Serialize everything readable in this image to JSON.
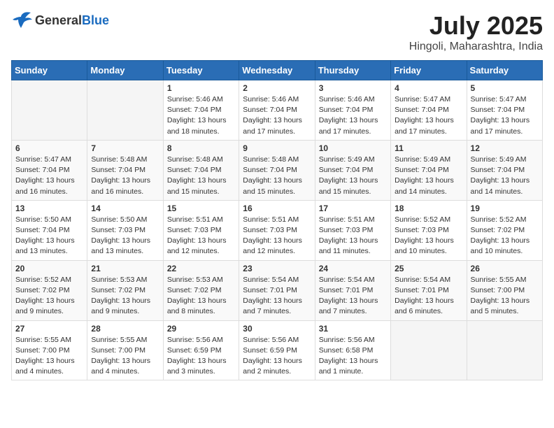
{
  "header": {
    "logo_general": "General",
    "logo_blue": "Blue",
    "month": "July 2025",
    "location": "Hingoli, Maharashtra, India"
  },
  "weekdays": [
    "Sunday",
    "Monday",
    "Tuesday",
    "Wednesday",
    "Thursday",
    "Friday",
    "Saturday"
  ],
  "weeks": [
    [
      {
        "day": "",
        "info": ""
      },
      {
        "day": "",
        "info": ""
      },
      {
        "day": "1",
        "info": "Sunrise: 5:46 AM\nSunset: 7:04 PM\nDaylight: 13 hours and 18 minutes."
      },
      {
        "day": "2",
        "info": "Sunrise: 5:46 AM\nSunset: 7:04 PM\nDaylight: 13 hours and 17 minutes."
      },
      {
        "day": "3",
        "info": "Sunrise: 5:46 AM\nSunset: 7:04 PM\nDaylight: 13 hours and 17 minutes."
      },
      {
        "day": "4",
        "info": "Sunrise: 5:47 AM\nSunset: 7:04 PM\nDaylight: 13 hours and 17 minutes."
      },
      {
        "day": "5",
        "info": "Sunrise: 5:47 AM\nSunset: 7:04 PM\nDaylight: 13 hours and 17 minutes."
      }
    ],
    [
      {
        "day": "6",
        "info": "Sunrise: 5:47 AM\nSunset: 7:04 PM\nDaylight: 13 hours and 16 minutes."
      },
      {
        "day": "7",
        "info": "Sunrise: 5:48 AM\nSunset: 7:04 PM\nDaylight: 13 hours and 16 minutes."
      },
      {
        "day": "8",
        "info": "Sunrise: 5:48 AM\nSunset: 7:04 PM\nDaylight: 13 hours and 15 minutes."
      },
      {
        "day": "9",
        "info": "Sunrise: 5:48 AM\nSunset: 7:04 PM\nDaylight: 13 hours and 15 minutes."
      },
      {
        "day": "10",
        "info": "Sunrise: 5:49 AM\nSunset: 7:04 PM\nDaylight: 13 hours and 15 minutes."
      },
      {
        "day": "11",
        "info": "Sunrise: 5:49 AM\nSunset: 7:04 PM\nDaylight: 13 hours and 14 minutes."
      },
      {
        "day": "12",
        "info": "Sunrise: 5:49 AM\nSunset: 7:04 PM\nDaylight: 13 hours and 14 minutes."
      }
    ],
    [
      {
        "day": "13",
        "info": "Sunrise: 5:50 AM\nSunset: 7:04 PM\nDaylight: 13 hours and 13 minutes."
      },
      {
        "day": "14",
        "info": "Sunrise: 5:50 AM\nSunset: 7:03 PM\nDaylight: 13 hours and 13 minutes."
      },
      {
        "day": "15",
        "info": "Sunrise: 5:51 AM\nSunset: 7:03 PM\nDaylight: 13 hours and 12 minutes."
      },
      {
        "day": "16",
        "info": "Sunrise: 5:51 AM\nSunset: 7:03 PM\nDaylight: 13 hours and 12 minutes."
      },
      {
        "day": "17",
        "info": "Sunrise: 5:51 AM\nSunset: 7:03 PM\nDaylight: 13 hours and 11 minutes."
      },
      {
        "day": "18",
        "info": "Sunrise: 5:52 AM\nSunset: 7:03 PM\nDaylight: 13 hours and 10 minutes."
      },
      {
        "day": "19",
        "info": "Sunrise: 5:52 AM\nSunset: 7:02 PM\nDaylight: 13 hours and 10 minutes."
      }
    ],
    [
      {
        "day": "20",
        "info": "Sunrise: 5:52 AM\nSunset: 7:02 PM\nDaylight: 13 hours and 9 minutes."
      },
      {
        "day": "21",
        "info": "Sunrise: 5:53 AM\nSunset: 7:02 PM\nDaylight: 13 hours and 9 minutes."
      },
      {
        "day": "22",
        "info": "Sunrise: 5:53 AM\nSunset: 7:02 PM\nDaylight: 13 hours and 8 minutes."
      },
      {
        "day": "23",
        "info": "Sunrise: 5:54 AM\nSunset: 7:01 PM\nDaylight: 13 hours and 7 minutes."
      },
      {
        "day": "24",
        "info": "Sunrise: 5:54 AM\nSunset: 7:01 PM\nDaylight: 13 hours and 7 minutes."
      },
      {
        "day": "25",
        "info": "Sunrise: 5:54 AM\nSunset: 7:01 PM\nDaylight: 13 hours and 6 minutes."
      },
      {
        "day": "26",
        "info": "Sunrise: 5:55 AM\nSunset: 7:00 PM\nDaylight: 13 hours and 5 minutes."
      }
    ],
    [
      {
        "day": "27",
        "info": "Sunrise: 5:55 AM\nSunset: 7:00 PM\nDaylight: 13 hours and 4 minutes."
      },
      {
        "day": "28",
        "info": "Sunrise: 5:55 AM\nSunset: 7:00 PM\nDaylight: 13 hours and 4 minutes."
      },
      {
        "day": "29",
        "info": "Sunrise: 5:56 AM\nSunset: 6:59 PM\nDaylight: 13 hours and 3 minutes."
      },
      {
        "day": "30",
        "info": "Sunrise: 5:56 AM\nSunset: 6:59 PM\nDaylight: 13 hours and 2 minutes."
      },
      {
        "day": "31",
        "info": "Sunrise: 5:56 AM\nSunset: 6:58 PM\nDaylight: 13 hours and 1 minute."
      },
      {
        "day": "",
        "info": ""
      },
      {
        "day": "",
        "info": ""
      }
    ]
  ]
}
